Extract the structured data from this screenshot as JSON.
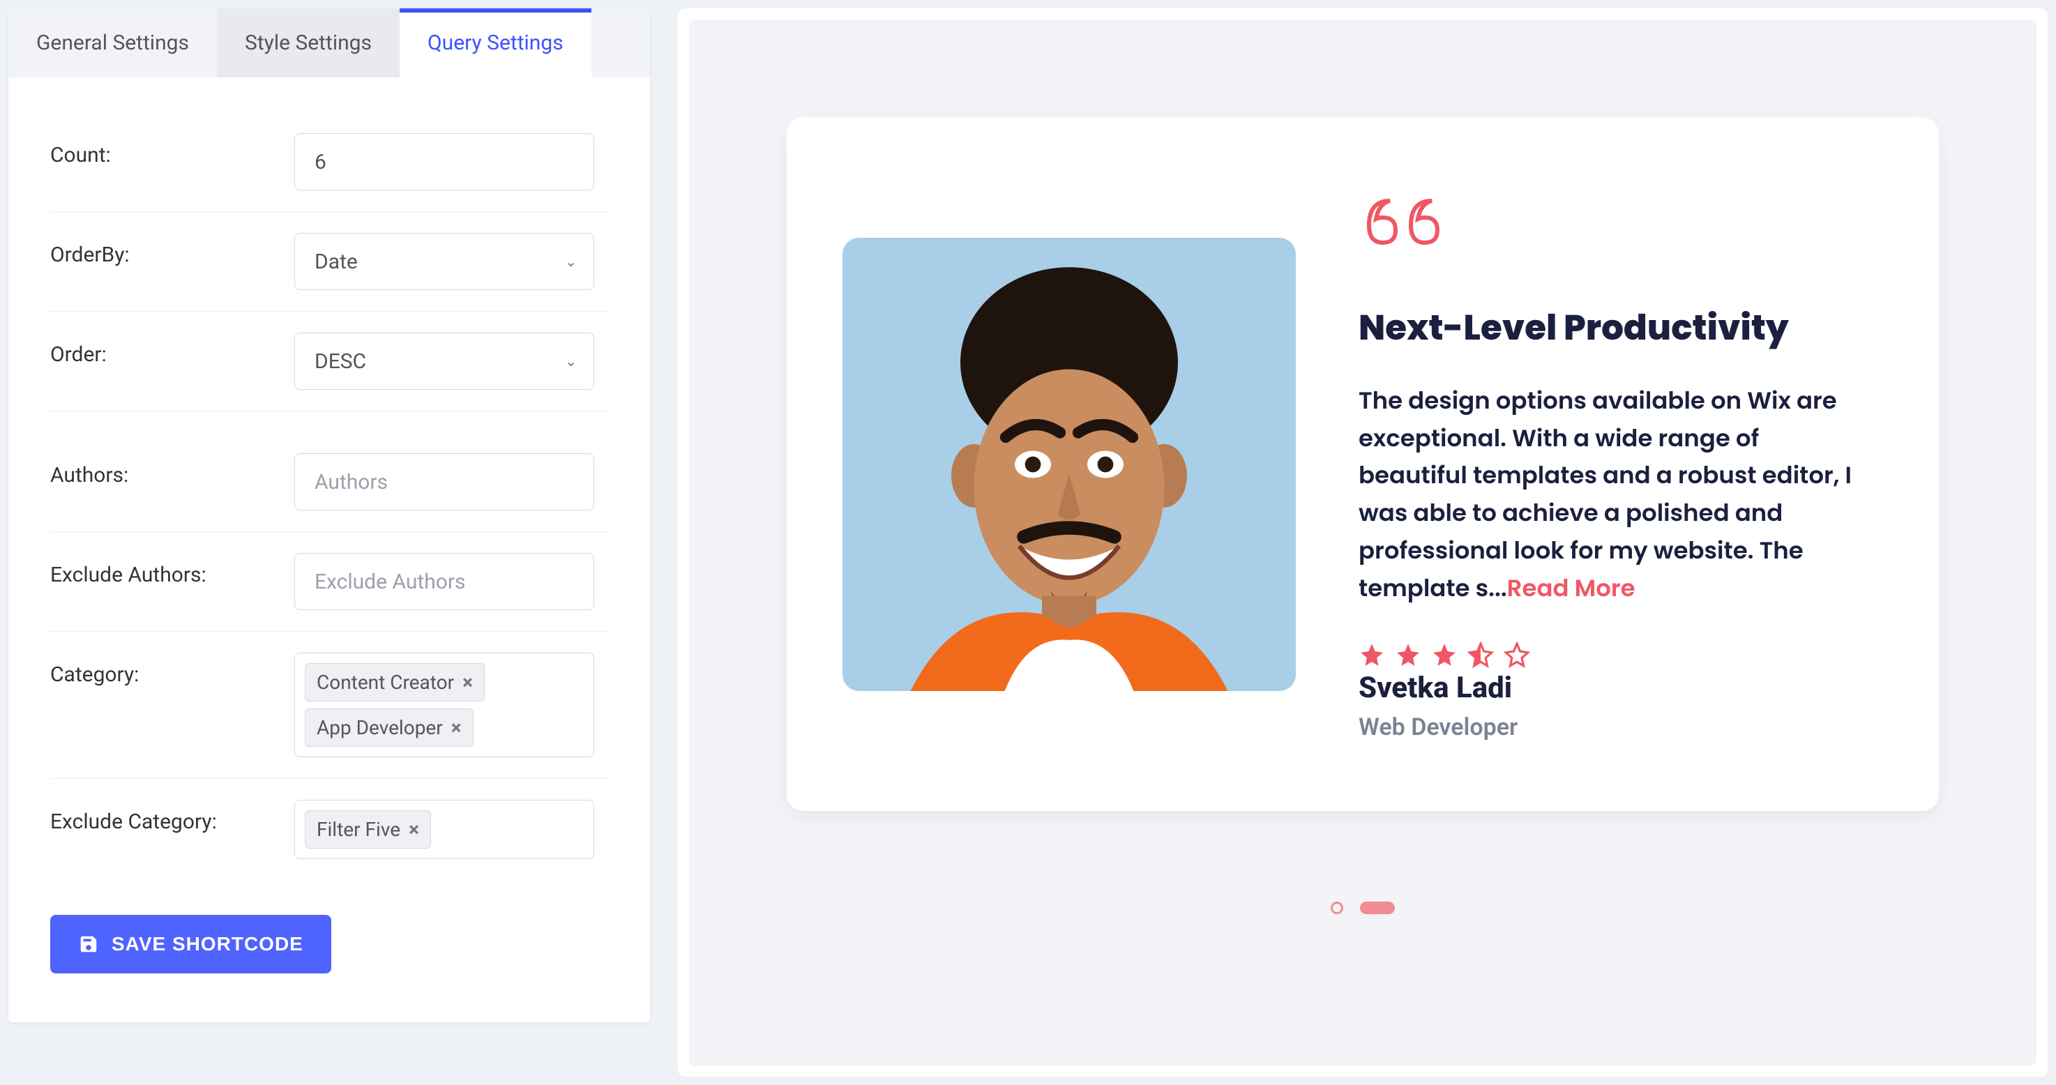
{
  "tabs": {
    "general": "General Settings",
    "style": "Style Settings",
    "query": "Query Settings"
  },
  "form": {
    "count_label": "Count:",
    "count_value": "6",
    "orderby_label": "OrderBy:",
    "orderby_value": "Date",
    "order_label": "Order:",
    "order_value": "DESC",
    "authors_label": "Authors:",
    "authors_placeholder": "Authors",
    "exclude_authors_label": "Exclude Authors:",
    "exclude_authors_placeholder": "Exclude Authors",
    "category_label": "Category:",
    "category_tags": [
      "Content Creator",
      "App Developer"
    ],
    "exclude_category_label": "Exclude Category:",
    "exclude_category_tags": [
      "Filter Five"
    ],
    "save_label": "SAVE SHORTCODE"
  },
  "testimonial": {
    "title": "Next-Level Productivity",
    "body": "The design options available on Wix are exceptional. With a wide range of beautiful templates and a robust editor, I was able to achieve a polished and professional look for my website. The template s...",
    "read_more": "Read More",
    "author": "Svetka Ladi",
    "role": "Web Developer",
    "rating": 3.5
  },
  "colors": {
    "accent": "#f05663",
    "primary": "#4f63ff"
  }
}
